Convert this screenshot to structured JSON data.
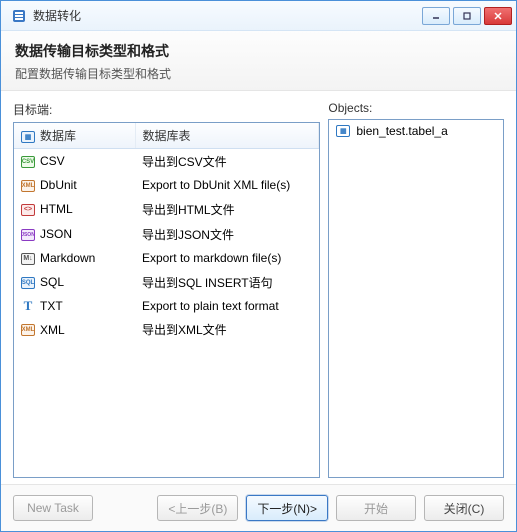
{
  "window": {
    "title": "数据转化"
  },
  "header": {
    "title": "数据传输目标类型和格式",
    "subtitle": "配置数据传输目标类型和格式"
  },
  "left": {
    "label": "目标端:",
    "columns": {
      "c0": "数据库",
      "c1": "数据库表"
    },
    "rows": [
      {
        "icon": "csv",
        "iconTxt": "CSV",
        "name": "CSV",
        "desc": "导出到CSV文件"
      },
      {
        "icon": "xml",
        "iconTxt": "XML",
        "name": "DbUnit",
        "desc": "Export to DbUnit XML file(s)"
      },
      {
        "icon": "html",
        "iconTxt": "<>",
        "name": "HTML",
        "desc": "导出到HTML文件"
      },
      {
        "icon": "json",
        "iconTxt": "JSON",
        "name": "JSON",
        "desc": "导出到JSON文件"
      },
      {
        "icon": "md",
        "iconTxt": "M↓",
        "name": "Markdown",
        "desc": "Export to markdown file(s)"
      },
      {
        "icon": "sql",
        "iconTxt": "SQL",
        "name": "SQL",
        "desc": "导出到SQL INSERT语句"
      },
      {
        "icon": "txt",
        "iconTxt": "T",
        "name": "TXT",
        "desc": "Export to plain text format"
      },
      {
        "icon": "xml",
        "iconTxt": "XML",
        "name": "XML",
        "desc": "导出到XML文件"
      }
    ]
  },
  "right": {
    "label": "Objects:",
    "items": [
      {
        "icon": "tbl",
        "name": "bien_test.tabel_a"
      }
    ]
  },
  "footer": {
    "newtask": "New Task",
    "back": "<上一步(B)",
    "next": "下一步(N)>",
    "start": "开始",
    "close": "关闭(C)"
  }
}
